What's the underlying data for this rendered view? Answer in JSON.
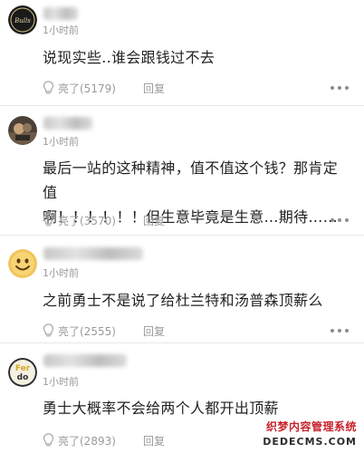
{
  "comments": [
    {
      "avatar_icon": "bulls-logo-avatar-icon",
      "time": "1小时前",
      "text": "说现实些..谁会跟钱过不去",
      "like_label": "亮了(5179)",
      "reply_label": "回复"
    },
    {
      "avatar_icon": "photo-avatar-icon",
      "time": "1小时前",
      "text_lines": [
        "最后一站的这种精神，值不值这个钱？那肯定值",
        "啊！！！！！！但生意毕竟是生意…期待……"
      ],
      "like_label": "亮了(3570)",
      "reply_label": "回复"
    },
    {
      "avatar_icon": "smiley-avatar-icon",
      "time": "1小时前",
      "text": "之前勇士不是说了给杜兰特和汤普森顶薪么",
      "like_label": "亮了(2555)",
      "reply_label": "回复"
    },
    {
      "avatar_icon": "fernando-logo-avatar-icon",
      "time": "1小时前",
      "text": "勇士大概率不会给两个人都开出顶薪",
      "like_label": "亮了(2893)",
      "reply_label": "回复"
    }
  ],
  "watermark": {
    "line1": "织梦内容管理系统",
    "line2": "DEDECMS.COM"
  }
}
